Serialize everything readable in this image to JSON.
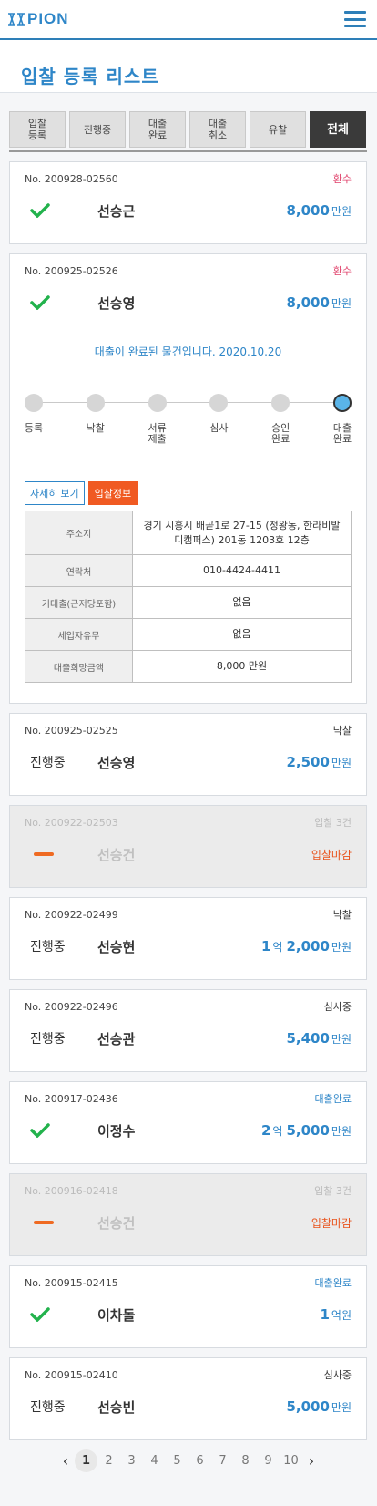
{
  "header": {
    "logo_text": "PION"
  },
  "page": {
    "title": "입찰 등록 리스트"
  },
  "tabs": [
    {
      "label": "입찰\n등록"
    },
    {
      "label": "진행중"
    },
    {
      "label": "대출\n완료"
    },
    {
      "label": "대출\n취소"
    },
    {
      "label": "유찰"
    },
    {
      "label": "전체"
    }
  ],
  "cards": [
    {
      "no": "No. 200928-02560",
      "status": "환수",
      "lead": "",
      "name": "선승근",
      "amount_num": "8,000",
      "amount_unit": "만원"
    },
    {
      "no": "No. 200925-02526",
      "status": "환수",
      "lead": "",
      "name": "선승영",
      "amount_num": "8,000",
      "amount_unit": "만원"
    },
    {
      "no": "No. 200925-02525",
      "status": "낙찰",
      "lead": "진행중",
      "name": "선승영",
      "amount_num": "2,500",
      "amount_unit": "만원"
    },
    {
      "no": "No. 200922-02503",
      "status": "입찰 3건",
      "lead": "",
      "name": "선승건",
      "closed": "입찰마감"
    },
    {
      "no": "No. 200922-02499",
      "status": "낙찰",
      "lead": "진행중",
      "name": "선승현",
      "amount_a": "1",
      "unit_a": "억",
      "amount_num": "2,000",
      "amount_unit": "만원"
    },
    {
      "no": "No. 200922-02496",
      "status": "심사중",
      "lead": "진행중",
      "name": "선승관",
      "amount_num": "5,400",
      "amount_unit": "만원"
    },
    {
      "no": "No. 200917-02436",
      "status": "대출완료",
      "lead": "",
      "name": "이정수",
      "amount_a": "2",
      "unit_a": "억",
      "amount_num": "5,000",
      "amount_unit": "만원"
    },
    {
      "no": "No. 200916-02418",
      "status": "입찰 3건",
      "lead": "",
      "name": "선승건",
      "closed": "입찰마감"
    },
    {
      "no": "No. 200915-02415",
      "status": "대출완료",
      "lead": "",
      "name": "이차돌",
      "amount_num": "1",
      "amount_unit": "억원"
    },
    {
      "no": "No. 200915-02410",
      "status": "심사중",
      "lead": "진행중",
      "name": "선승빈",
      "amount_num": "5,000",
      "amount_unit": "만원"
    }
  ],
  "detail": {
    "complete_msg": "대출이 완료된 물건입니다. 2020.10.20",
    "steps": [
      "등록",
      "낙찰",
      "서류\n제출",
      "심사",
      "승인\n완료",
      "대출\n완료"
    ],
    "current_step": 6,
    "btn_detail": "자세히 보기",
    "btn_bid": "입찰정보",
    "rows": [
      {
        "k": "주소지",
        "v": "경기 시흥시 배곧1로 27-15 (정왕동, 한라비발디캠퍼스) 201동 1203호 12층"
      },
      {
        "k": "연락처",
        "v": "010-4424-4411"
      },
      {
        "k": "기대출(근저당포함)",
        "v": "없음"
      },
      {
        "k": "세입자유무",
        "v": "없음"
      },
      {
        "k": "대출희망금액",
        "v": "8,000 만원"
      }
    ]
  },
  "pager": {
    "pages": [
      "1",
      "2",
      "3",
      "4",
      "5",
      "6",
      "7",
      "8",
      "9",
      "10"
    ],
    "current": "1",
    "prev": "‹",
    "next": "›"
  },
  "colors": {
    "accent": "#2e86c8",
    "red_status": "#e0406a",
    "orange": "#f05a22",
    "check_green": "#22b24c"
  }
}
